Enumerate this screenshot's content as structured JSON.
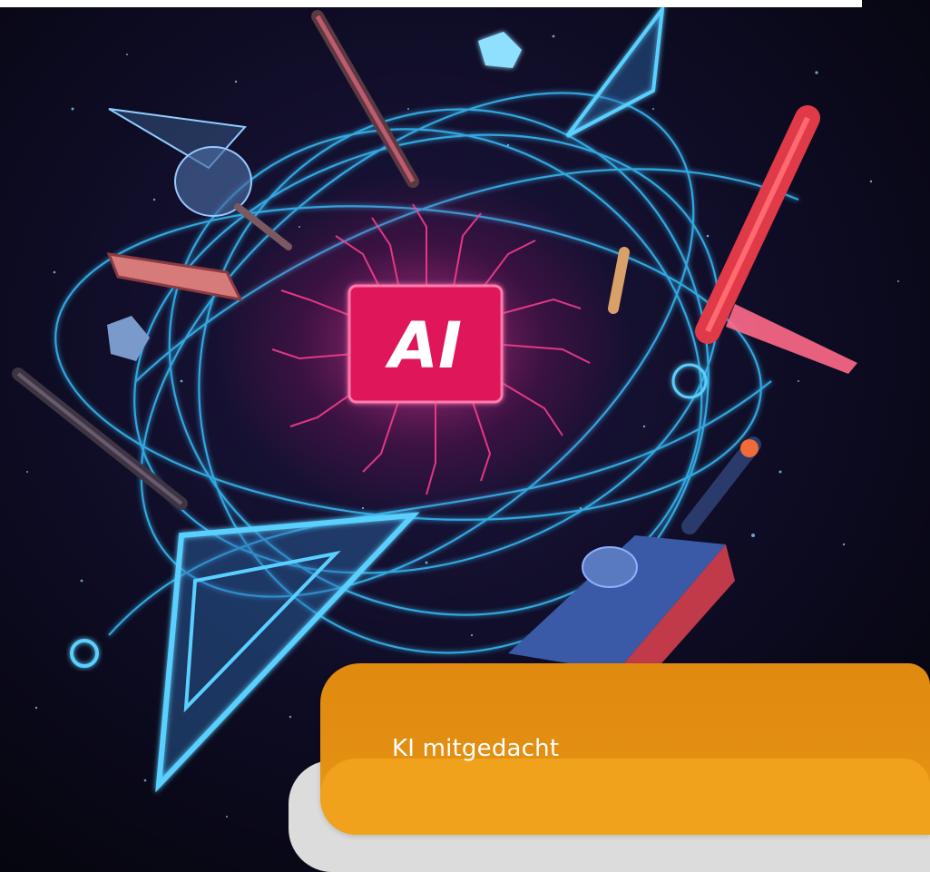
{
  "hero": {
    "chip_text": "AI",
    "alt_subject": "ai-education-illustration"
  },
  "card": {
    "label": "KI mitgedacht"
  },
  "colors": {
    "background": "#0b0a1c",
    "glow_cyan": "#39c2ff",
    "glow_magenta": "#ff2a7a",
    "card_orange": "#e38f12",
    "card_orange_light": "#f0a21c",
    "card_grey": "#dcdcdc",
    "text_white": "#ffffff"
  }
}
